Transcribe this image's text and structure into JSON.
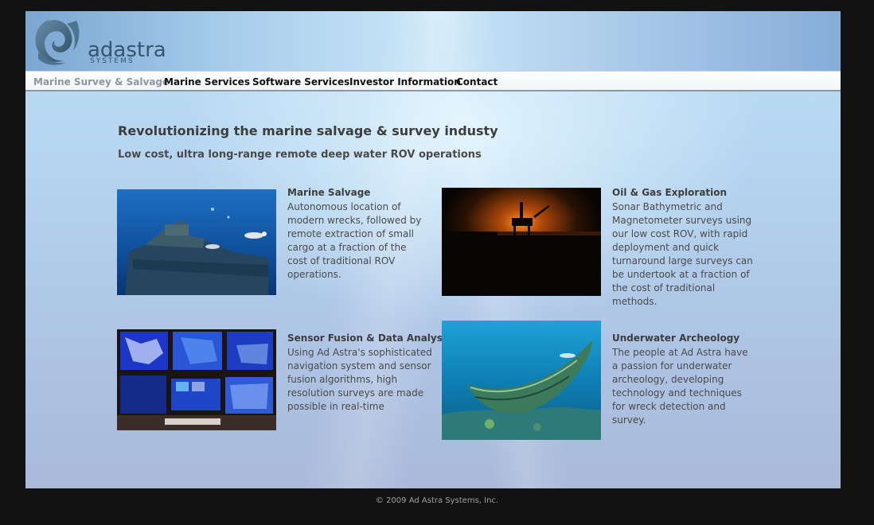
{
  "brand": {
    "name": "adastra",
    "tagline": "SYSTEMS"
  },
  "nav": {
    "items": [
      {
        "label": "Marine Survey & Salvage",
        "active": true
      },
      {
        "label": "Marine Services"
      },
      {
        "label": "Software Services"
      },
      {
        "label": "Investor Information"
      },
      {
        "label": "Contact"
      }
    ]
  },
  "main": {
    "headline": "Revolutionizing the marine salvage & survey industy",
    "subheadline": "Low cost, ultra long-range remote deep water ROV operations",
    "cards": [
      {
        "title": "Marine Salvage",
        "lines": [
          "Autonomous location of",
          "modern wrecks, followed by",
          "remote extraction of small",
          "cargo at a fraction of the",
          "cost of traditional ROV",
          "operations."
        ],
        "image": "diver-wreck-image"
      },
      {
        "title": "Oil & Gas Exploration",
        "lines": [
          "Sonar Bathymetric and",
          "Magnetometer surveys using",
          "our low cost ROV, with rapid",
          "deployment and quick",
          "turnaround large surveys can",
          "be undertook at a fraction of",
          "the cost of traditional",
          "methods."
        ],
        "image": "oil-rig-sunset-image"
      },
      {
        "title": "Sensor Fusion & Data Analysis",
        "lines": [
          "Using Ad Astra's sophisticated",
          "navigation system and sensor",
          "fusion algorithms, high",
          "resolution surveys are made",
          "possible in real-time"
        ],
        "image": "monitor-wall-image"
      },
      {
        "title": "Underwater Archeology",
        "lines": [
          "The people at Ad Astra have",
          "a passion for underwater",
          "archeology, developing",
          "technology and techniques",
          "for wreck detection and",
          "survey."
        ],
        "image": "sunken-boat-image"
      }
    ]
  },
  "footer": {
    "copyright": "© 2009 Ad Astra Systems, Inc."
  },
  "colors": {
    "page_bg": "#121212",
    "ocean_light": "#c9e6f8",
    "ocean_dark": "#a9b9d9",
    "logo": "#35556d"
  }
}
